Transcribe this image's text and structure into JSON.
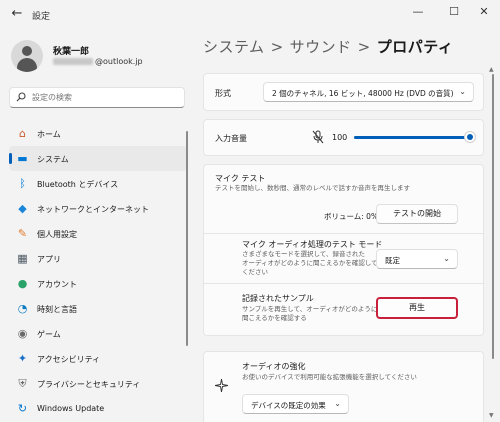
{
  "window": {
    "title": "設定",
    "back_glyph": "←",
    "minimize_glyph": "—",
    "maximize_glyph": "☐",
    "close_glyph": "✕"
  },
  "profile": {
    "name": "秋葉一郎",
    "email_visible": "@outlook.jp"
  },
  "search": {
    "placeholder": "設定の検索",
    "icon": "search-icon"
  },
  "sidebar": {
    "items": [
      {
        "label": "ホーム",
        "icon": "home-icon",
        "glyph": "⌂",
        "color": "#c75b2c"
      },
      {
        "label": "システム",
        "icon": "system-icon",
        "glyph": "▬",
        "color": "#0078d4",
        "selected": true
      },
      {
        "label": "Bluetooth とデバイス",
        "icon": "bluetooth-icon",
        "glyph": "ᛒ",
        "color": "#0078d4"
      },
      {
        "label": "ネットワークとインターネット",
        "icon": "network-icon",
        "glyph": "◆",
        "color": "#1a86d9"
      },
      {
        "label": "個人用設定",
        "icon": "brush-icon",
        "glyph": "✎",
        "color": "#e07a2c"
      },
      {
        "label": "アプリ",
        "icon": "apps-icon",
        "glyph": "▦",
        "color": "#4a5560"
      },
      {
        "label": "アカウント",
        "icon": "account-icon",
        "glyph": "●",
        "color": "#2aa36a"
      },
      {
        "label": "時刻と言語",
        "icon": "time-language-icon",
        "glyph": "◔",
        "color": "#0a7cc4"
      },
      {
        "label": "ゲーム",
        "icon": "gaming-icon",
        "glyph": "◉",
        "color": "#6b6b6b"
      },
      {
        "label": "アクセシビリティ",
        "icon": "accessibility-icon",
        "glyph": "✦",
        "color": "#1a6fc9"
      },
      {
        "label": "プライバシーとセキュリティ",
        "icon": "shield-icon",
        "glyph": "⛨",
        "color": "#6b6b6b"
      },
      {
        "label": "Windows Update",
        "icon": "update-icon",
        "glyph": "↻",
        "color": "#0078d4"
      }
    ]
  },
  "breadcrumb": {
    "part1": "システム",
    "part2": "サウンド",
    "part3": "プロパティ",
    "separator": ">"
  },
  "format": {
    "label": "形式",
    "value": "2 個のチャネル, 16 ビット, 48000 Hz (DVD の音質)"
  },
  "input_volume": {
    "label": "入力音量",
    "value": "100",
    "level_percent": 100,
    "icon": "mic-muted-icon"
  },
  "mic_test": {
    "title": "マイク テスト",
    "description": "テストを開始し、数秒間、通常のレベルで話すか音声を再生します",
    "volume_text": "ボリューム: 0%",
    "start_button": "テストの開始",
    "mode_title": "マイク オーディオ処理のテスト モード",
    "mode_desc_1": "さまざまなモードを選択して、録音された",
    "mode_desc_2": "オーディオがどのように聞こえるかを確認して",
    "mode_desc_3": "ください",
    "mode_value": "既定",
    "sample_title": "記録されたサンプル",
    "sample_desc_1": "サンプルを再生して、オーディオがどのように",
    "sample_desc_2": "聞こえるかを確認する",
    "play_button": "再生",
    "highlight_color": "#c8203a"
  },
  "enhance": {
    "title": "オーディオの強化",
    "description": "お使いのデバイスで利用可能な拡張機能を選択してください",
    "value": "デバイスの既定の効果",
    "icon": "sparkle-icon"
  },
  "colors": {
    "accent": "#005fb8"
  }
}
